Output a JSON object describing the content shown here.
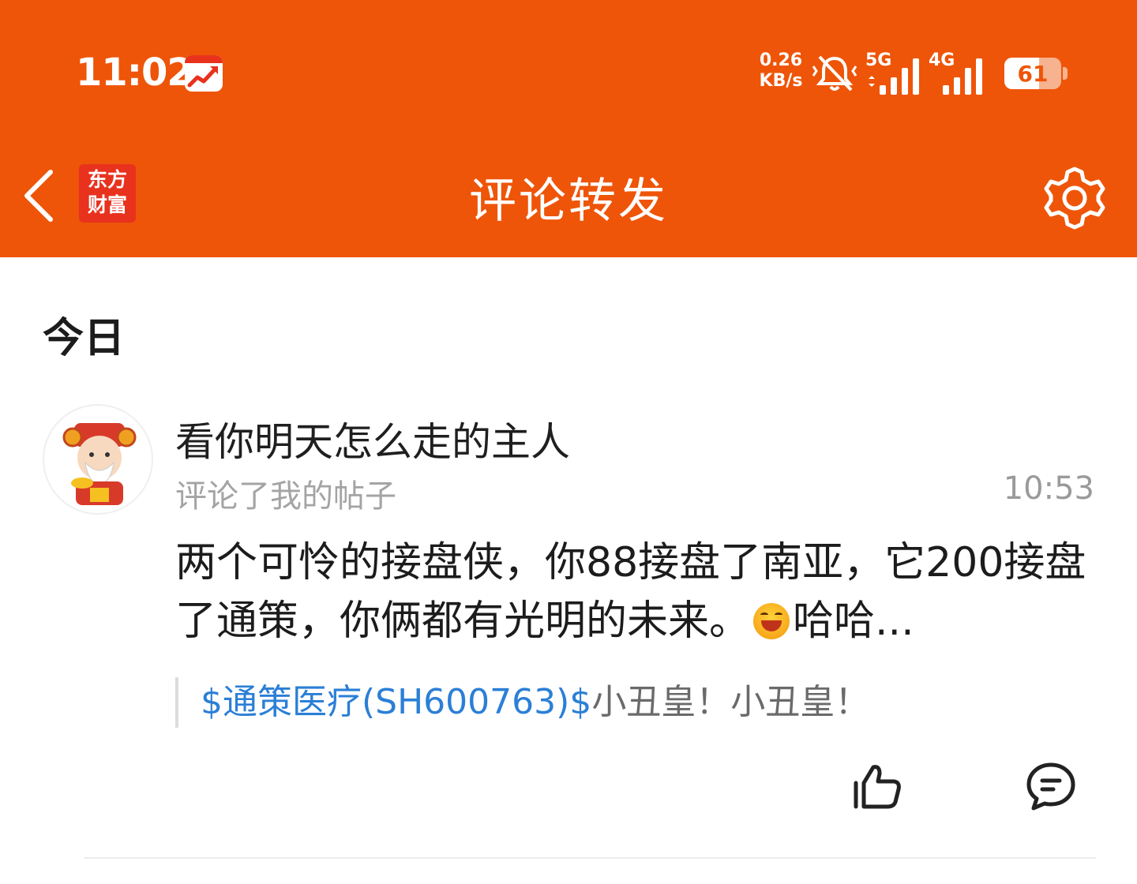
{
  "status_bar": {
    "time": "11:02",
    "network_speed_value": "0.26",
    "network_speed_unit": "KB/s",
    "sim1_label": "5G",
    "sim2_label": "4G",
    "battery": "61"
  },
  "header": {
    "title": "评论转发",
    "brand_line1": "东方",
    "brand_line2": "财富",
    "background_color": "#ee5508"
  },
  "section": {
    "date_label": "今日"
  },
  "notification": {
    "username": "看你明天怎么走的主人",
    "action": "评论了我的帖子",
    "time": "10:53",
    "comment_part1": "两个可怜的接盘侠，你88接盘了南亚，它200接盘了通策，你俩都有光明的未来。",
    "comment_part2": "哈哈...",
    "quote_link": "$通策医疗(SH600763)$",
    "quote_text": "小丑皇！小丑皇！",
    "link_color": "#2b7fd6"
  },
  "icons": {
    "back": "chevron-left-icon",
    "settings": "gear-icon",
    "like": "thumbs-up-icon",
    "reply": "comment-bubble-icon",
    "emoji": "laughing-emoji"
  }
}
